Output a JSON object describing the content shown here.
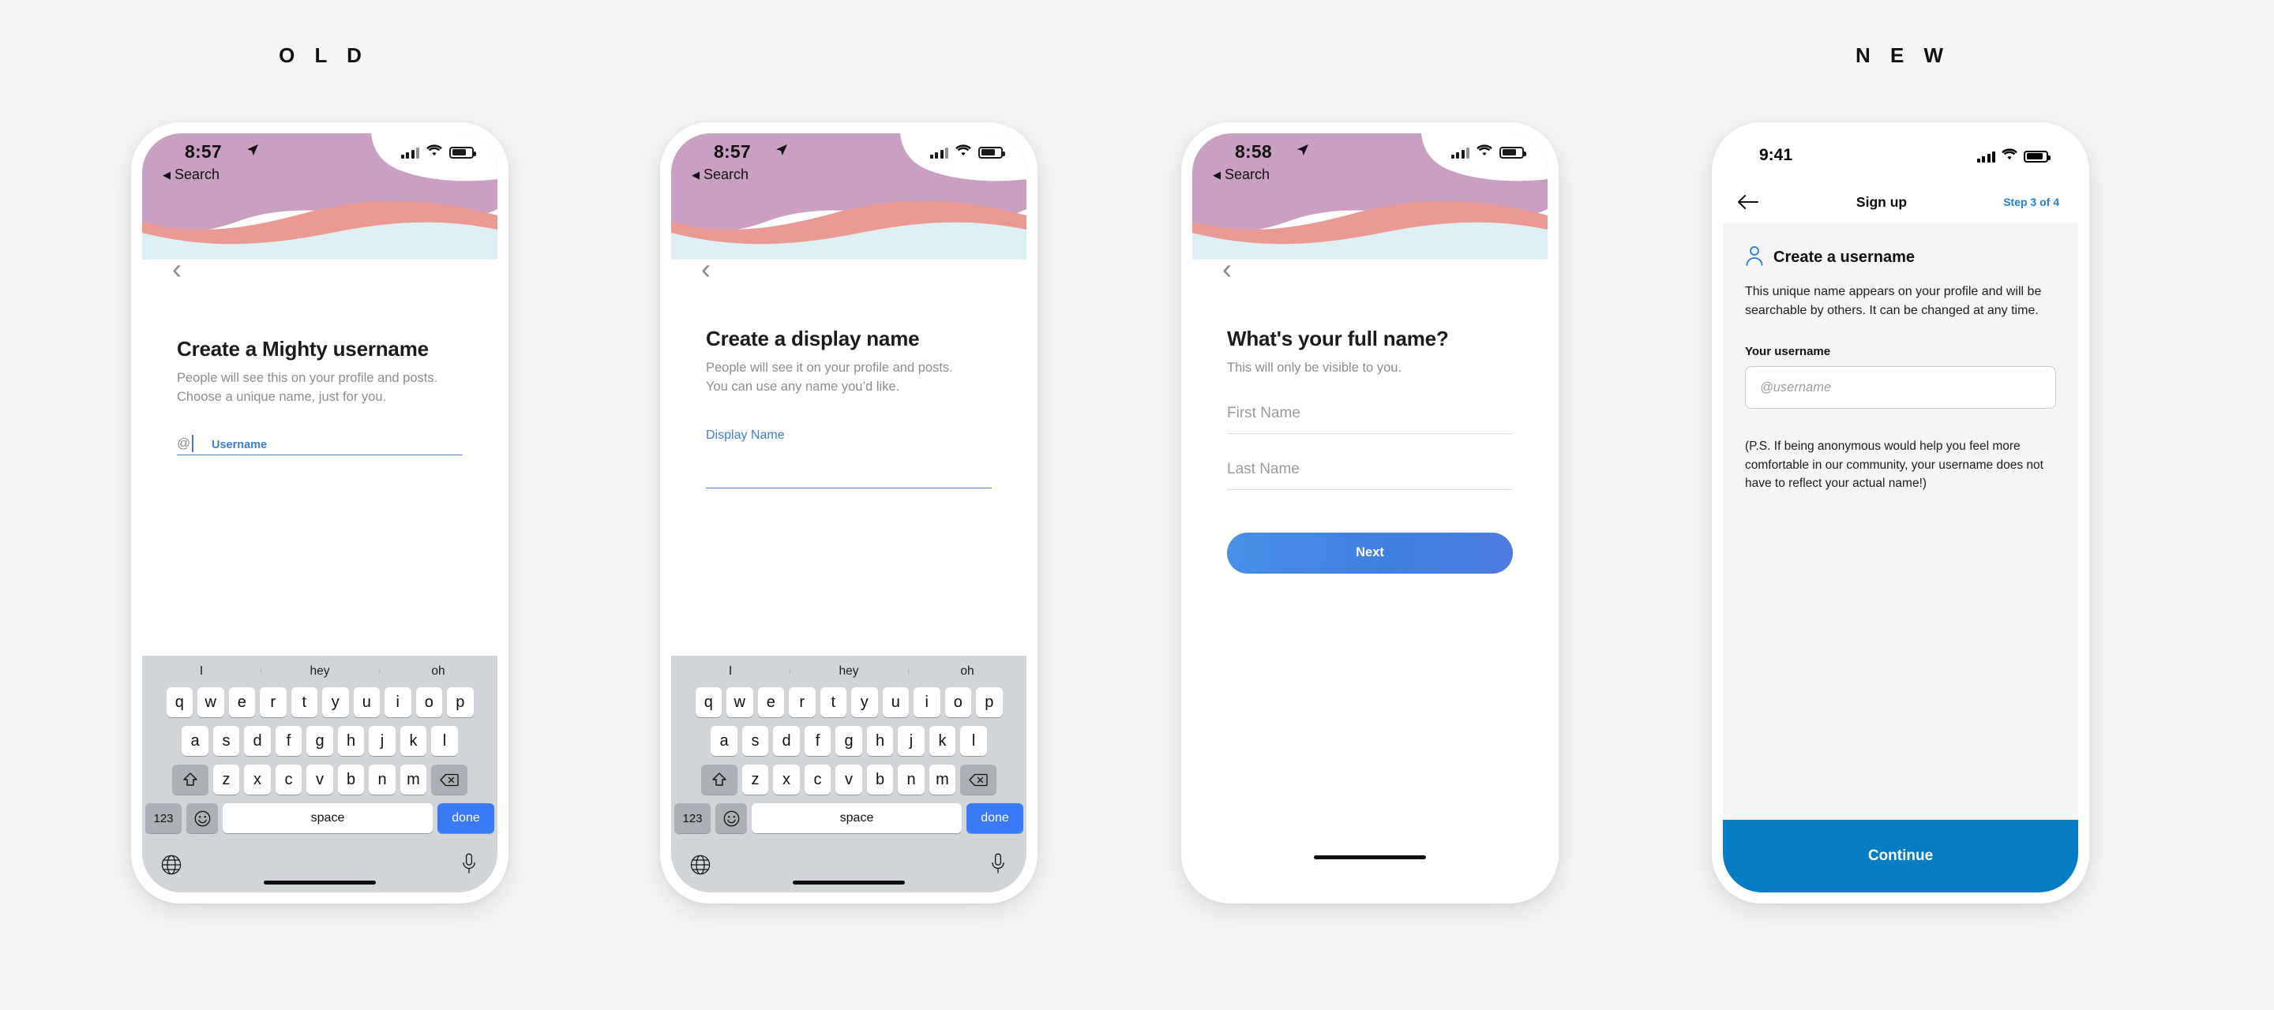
{
  "captions": {
    "old": "O L D",
    "new": "N E W"
  },
  "screens": {
    "old1": {
      "status": {
        "time": "8:57",
        "back": "Search",
        "location_icon": "location-arrow-icon"
      },
      "title": "Create a Mighty username",
      "sub_line1": "People will see this on your profile and posts.",
      "sub_line2": "Choose a unique name, just for you.",
      "field_label": "Username",
      "field_prefix": "@"
    },
    "old2": {
      "status": {
        "time": "8:57",
        "back": "Search"
      },
      "title": "Create a display name",
      "sub_line1": "People will see it on your profile and posts.",
      "sub_line2": "You can use any name you’d like.",
      "field_label": "Display Name"
    },
    "old3": {
      "status": {
        "time": "8:58",
        "back": "Search"
      },
      "title": "What's your full name?",
      "sub_line1": "This will only be visible to you.",
      "first_placeholder": "First Name",
      "last_placeholder": "Last Name",
      "next_label": "Next"
    },
    "new": {
      "status": {
        "time": "9:41"
      },
      "nav": {
        "title": "Sign up",
        "step": "Step 3 of 4",
        "back_icon": "arrow-left-icon"
      },
      "section_title": "Create a username",
      "section_icon": "person-icon",
      "description": "This unique name appears on your profile and will be searchable by others. It can be changed at any time.",
      "field_label": "Your username",
      "field_placeholder": "@username",
      "ps_note": "(P.S. If being anonymous would help you feel more comfortable in our community, your username does not have to reflect your actual name!)",
      "cta_label": "Continue"
    }
  },
  "keyboard": {
    "predictions": [
      "I",
      "hey",
      "oh"
    ],
    "row1": [
      "q",
      "w",
      "e",
      "r",
      "t",
      "y",
      "u",
      "i",
      "o",
      "p"
    ],
    "row2": [
      "a",
      "s",
      "d",
      "f",
      "g",
      "h",
      "j",
      "k",
      "l"
    ],
    "row3": [
      "z",
      "x",
      "c",
      "v",
      "b",
      "n",
      "m"
    ],
    "shift_icon": "shift-up-icon",
    "backspace_icon": "backspace-icon",
    "numbers_label": "123",
    "emoji_icon": "emoji-smiley-icon",
    "space_label": "space",
    "done_label": "done",
    "globe_icon": "globe-icon",
    "mic_icon": "microphone-icon"
  },
  "colors": {
    "accent_blue": "#3b7af5",
    "new_brand_blue": "#047dc4",
    "link_blue": "#1f7fd4",
    "wave_purple": "#c9a0c2",
    "wave_salmon": "#eb9a93",
    "wave_ice": "#dff0f4",
    "page_bg": "#f5f5f5"
  }
}
